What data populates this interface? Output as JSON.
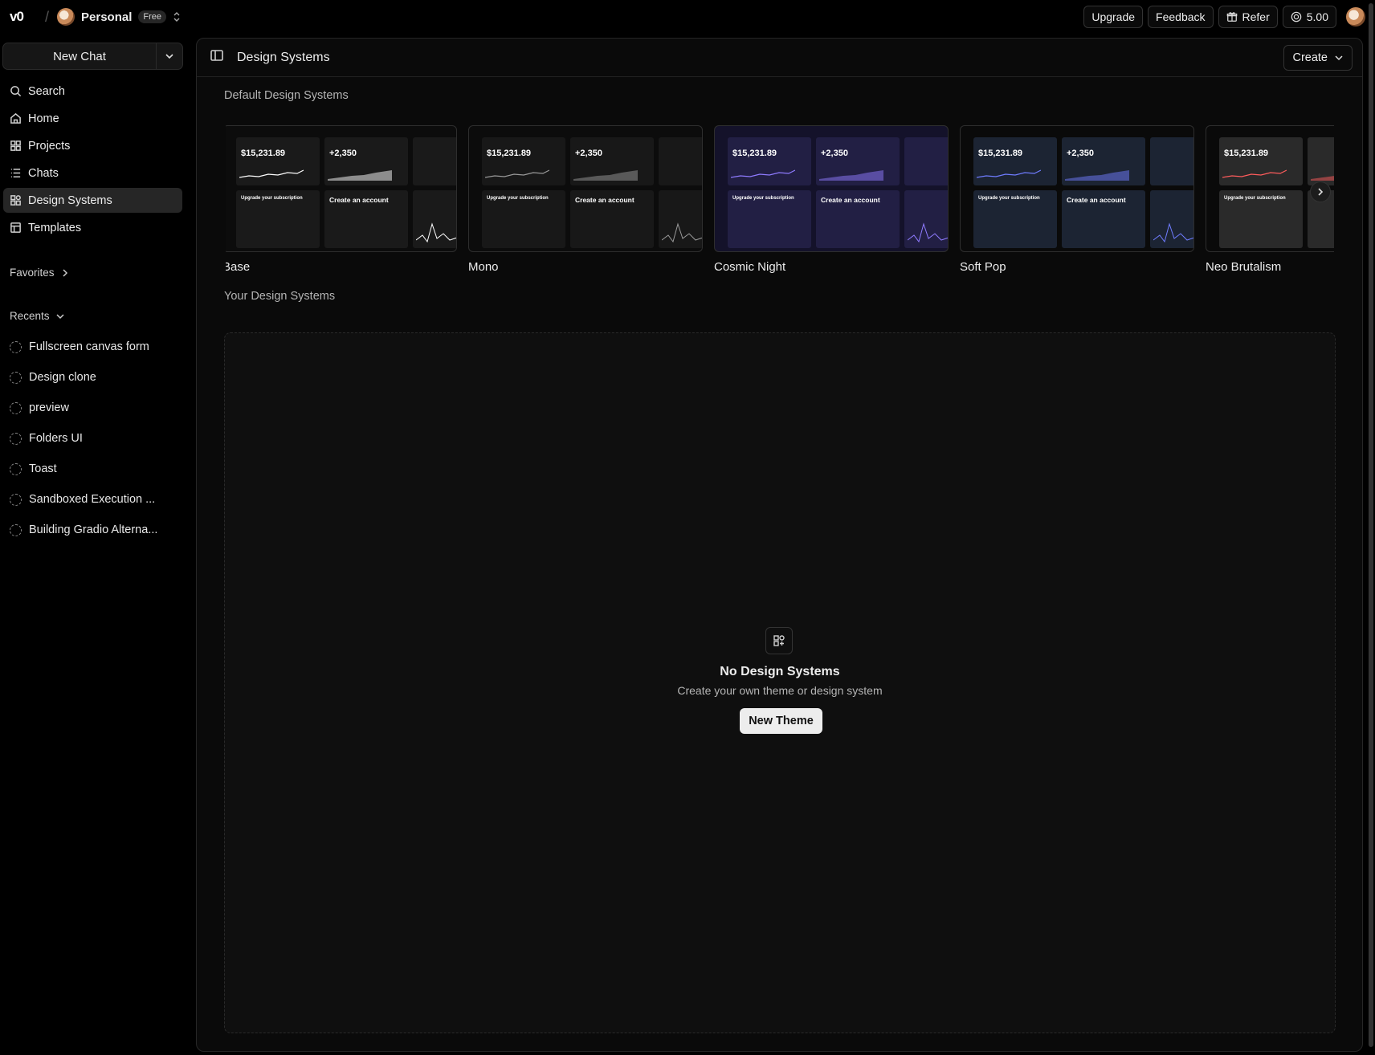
{
  "topbar": {
    "logo": "v0",
    "separator": "/",
    "team_name": "Personal",
    "plan_badge": "Free",
    "buttons": {
      "upgrade": "Upgrade",
      "feedback": "Feedback",
      "refer": "Refer",
      "credits": "5.00"
    }
  },
  "sidebar": {
    "new_chat": "New Chat",
    "nav": [
      {
        "label": "Search",
        "icon": "search-icon"
      },
      {
        "label": "Home",
        "icon": "home-icon"
      },
      {
        "label": "Projects",
        "icon": "grid-icon"
      },
      {
        "label": "Chats",
        "icon": "list-icon"
      },
      {
        "label": "Design Systems",
        "icon": "design-systems-icon",
        "active": true
      },
      {
        "label": "Templates",
        "icon": "template-icon"
      }
    ],
    "favorites_label": "Favorites",
    "recents_label": "Recents",
    "recents": [
      "Fullscreen canvas form",
      "Design clone",
      "preview",
      "Folders UI",
      "Toast",
      "Sandboxed Execution ...",
      "Building Gradio Alterna..."
    ]
  },
  "main": {
    "title": "Design Systems",
    "create_label": "Create",
    "default_title": "Default Design Systems",
    "default_systems": [
      {
        "name": "Base",
        "bg": "#0c0c0c",
        "panel": "#1a1a1a",
        "accent": "#ffffff",
        "thumb": {
          "revenue": "$15,231.89",
          "subs": "+2,350",
          "upgrade": "Upgrade your subscription",
          "account": "Create an account"
        }
      },
      {
        "name": "Mono",
        "bg": "#0c0c0c",
        "panel": "#181818",
        "accent": "#9a9a9a",
        "thumb": {
          "revenue": "$15,231.89",
          "subs": "+2,350",
          "upgrade": "Upgrade your subscription",
          "account": "Create an account"
        }
      },
      {
        "name": "Cosmic Night",
        "bg": "#14122a",
        "panel": "#221f44",
        "accent": "#8f7bff",
        "thumb": {
          "revenue": "$15,231.89",
          "subs": "+2,350",
          "upgrade": "Upgrade your subscription",
          "account": "Create an account"
        }
      },
      {
        "name": "Soft Pop",
        "bg": "#0a0a0a",
        "panel": "#1c2433",
        "accent": "#6f7cff",
        "thumb": {
          "revenue": "$15,231.89",
          "subs": "+2,350",
          "upgrade": "Upgrade your subscription",
          "account": "Create an account"
        }
      },
      {
        "name": "Neo Brutalism",
        "bg": "#0a0a0a",
        "panel": "#2a2a2a",
        "accent": "#ff5c5c",
        "thumb": {
          "revenue": "$15,231.89",
          "subs": "",
          "upgrade": "Upgrade your subscription",
          "account": ""
        }
      }
    ],
    "yours_title": "Your Design Systems",
    "empty": {
      "title": "No Design Systems",
      "subtitle": "Create your own theme or design system",
      "button": "New Theme"
    }
  }
}
